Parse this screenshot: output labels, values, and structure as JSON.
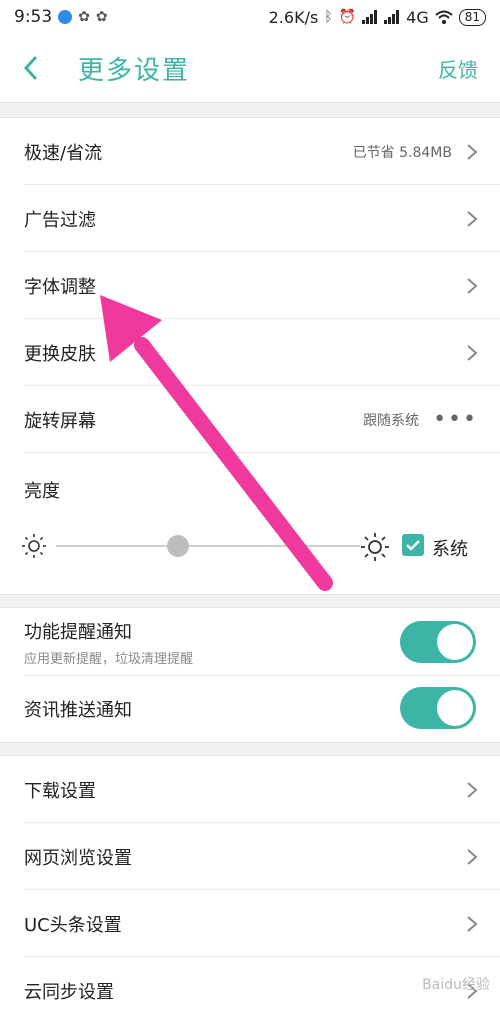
{
  "status": {
    "time": "9:53",
    "speed": "2.6K/s",
    "network": "4G",
    "battery": "81"
  },
  "header": {
    "title": "更多设置",
    "feedback": "反馈"
  },
  "section1": {
    "speed_mode": {
      "label": "极速/省流",
      "value": "已节省 5.84MB"
    },
    "ad_filter": {
      "label": "广告过滤"
    },
    "font_adjust": {
      "label": "字体调整"
    },
    "skin": {
      "label": "更换皮肤"
    },
    "rotate": {
      "label": "旋转屏幕",
      "value": "跟随系统"
    },
    "brightness": {
      "label": "亮度",
      "system_label": "系统",
      "system_checked": true,
      "level": 0.4
    }
  },
  "section2": {
    "func_notify": {
      "label": "功能提醒通知",
      "sub": "应用更新提醒，垃圾清理提醒",
      "on": true
    },
    "news_notify": {
      "label": "资讯推送通知",
      "on": true
    }
  },
  "section3": {
    "download": {
      "label": "下载设置"
    },
    "browse": {
      "label": "网页浏览设置"
    },
    "uc_headline": {
      "label": "UC头条设置"
    },
    "cloud_sync": {
      "label": "云同步设置"
    }
  },
  "colors": {
    "accent": "#3db5a6",
    "annotation_arrow": "#f0399c"
  },
  "watermark": "Baidu经验"
}
